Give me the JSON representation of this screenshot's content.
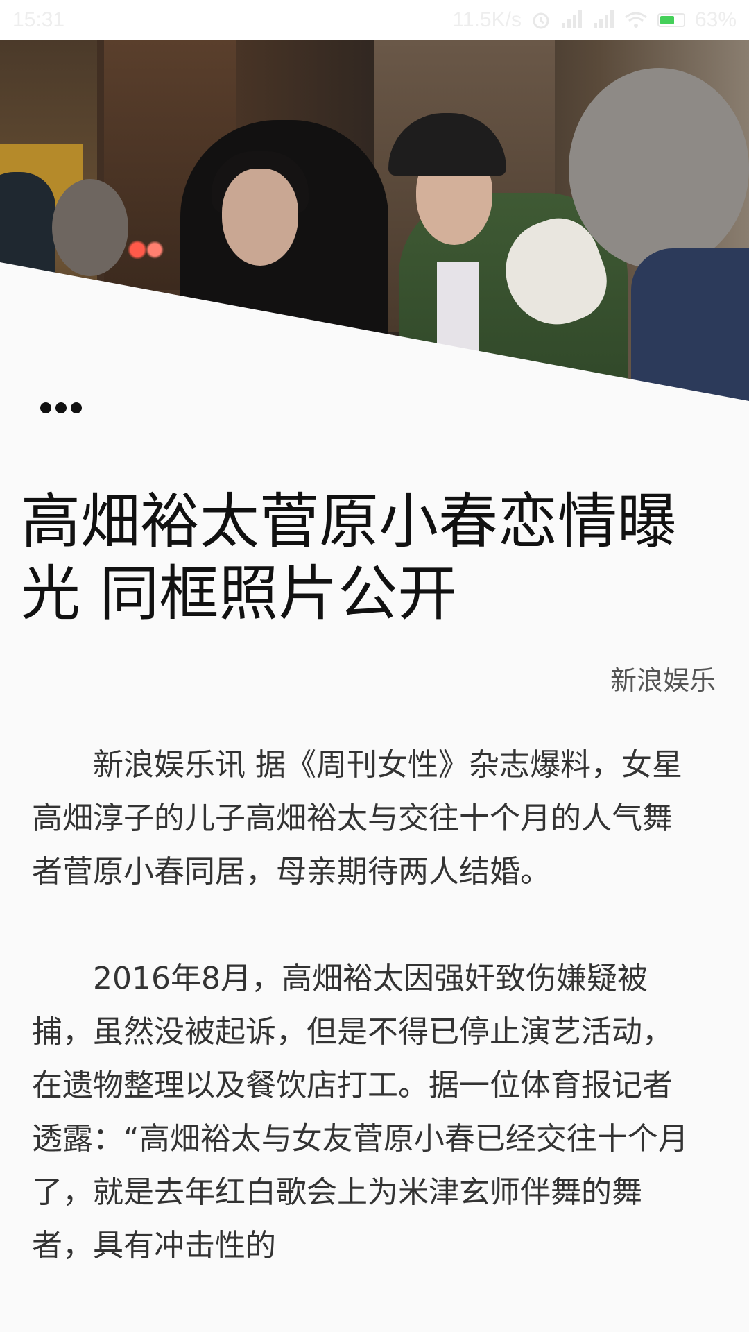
{
  "status_bar": {
    "time": "15:31",
    "network_speed": "11.5K/s",
    "battery_percent": "63%",
    "battery_level": 0.63,
    "icons": [
      "alarm-icon",
      "signal-icon",
      "signal-icon",
      "wifi-icon"
    ]
  },
  "hero": {
    "image_description_icon": "news-photo"
  },
  "toolbar": {
    "more_icon": "more-dots-icon"
  },
  "article": {
    "title": "高畑裕太菅原小春恋情曝光 同框照片公开",
    "source": "新浪娱乐",
    "paragraphs": [
      "新浪娱乐讯 据《周刊女性》杂志爆料，女星高畑淳子的儿子高畑裕太与交往十个月的人气舞者菅原小春同居，母亲期待两人结婚。",
      "2016年8月，高畑裕太因强奸致伤嫌疑被捕，虽然没被起诉，但是不得已停止演艺活动，在遗物整理以及餐饮店打工。据一位体育报记者透露：“高畑裕太与女友菅原小春已经交往十个月了，就是去年红白歌会上为米津玄师伴舞的舞者，具有冲击性的"
    ]
  }
}
